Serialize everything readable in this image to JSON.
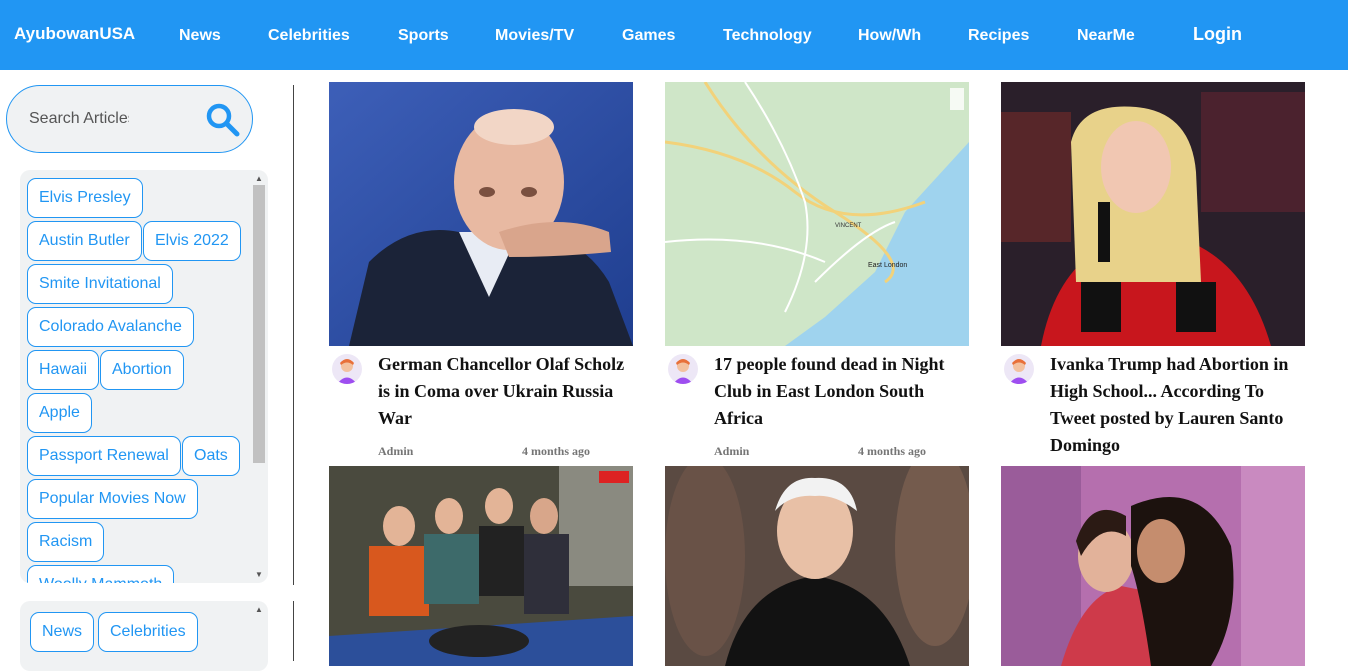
{
  "header": {
    "brand": "AyubowanUSA",
    "nav": [
      "News",
      "Celebrities",
      "Sports",
      "Movies/TV",
      "Games",
      "Technology",
      "How/Wh",
      "Recipes",
      "NearMe"
    ],
    "login": "Login"
  },
  "search": {
    "placeholder": "Search Articles"
  },
  "tags": [
    "Elvis Presley",
    "Austin Butler",
    "Elvis 2022",
    "Smite Invitational",
    "Colorado Avalanche",
    "Hawaii",
    "Abortion",
    "Apple",
    "Passport Renewal",
    "Oats",
    "Popular Movies Now",
    "Racism",
    "Woolly Mammoth"
  ],
  "categories": [
    "News",
    "Celebrities"
  ],
  "articles": [
    {
      "title": "German Chancellor Olaf Scholz is in Coma over Ukrain Russia War",
      "author": "Admin",
      "time": "4 months ago"
    },
    {
      "title": "17 people found dead in Night Club in East London South Africa",
      "author": "Admin",
      "time": "4 months ago"
    },
    {
      "title": "Ivanka Trump had Abortion in High School... According To Tweet posted by Lauren Santo Domingo",
      "author": "",
      "time": ""
    }
  ],
  "map_labels": [
    "East London",
    "VINCENT"
  ],
  "colors": {
    "primary": "#2196f3",
    "panel": "#f0f2f3"
  },
  "icons": {
    "search": "search-icon",
    "author": "avatar-icon"
  }
}
